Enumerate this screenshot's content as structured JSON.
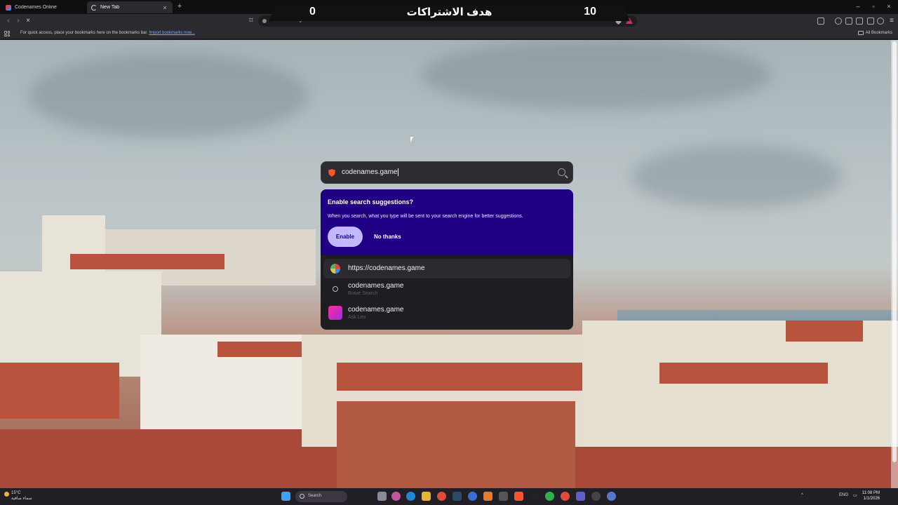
{
  "tabs": [
    {
      "label": "Codenames Online",
      "icon": "codenames-favicon-icon"
    },
    {
      "label": "New Tab",
      "icon": "loading-spinner-icon",
      "active": true
    }
  ],
  "overlay": {
    "left_value": "0",
    "title": "هدف الاشتراكات",
    "right_value": "10"
  },
  "address_bar": {
    "url": "codenames.game"
  },
  "bookmarks": {
    "prompt": "For quick access, place your bookmarks here on the bookmarks bar.",
    "import_link": "Import bookmarks now...",
    "all_bookmarks": "All Bookmarks"
  },
  "search": {
    "value": "codenames.game",
    "icon": "magnifier-icon"
  },
  "promo": {
    "title": "Enable search suggestions?",
    "description": "When you search, what you type will be sent to your search engine for better suggestions.",
    "enable_label": "Enable",
    "no_thanks_label": "No thanks",
    "bg_color": "#1f0085",
    "accent_color": "#c2b8ff"
  },
  "suggestions": [
    {
      "main": "https://codenames.game",
      "sub": "",
      "icon": "site-favicon-icon"
    },
    {
      "main": "codenames.game",
      "sub": "Brave Search",
      "icon": "search-icon"
    },
    {
      "main": "codenames.game",
      "sub": "Ask Leo",
      "icon": "leo-ai-icon"
    }
  ],
  "taskbar": {
    "weather_temp": "15°C",
    "weather_desc": "سماء صافية",
    "search_placeholder": "Search",
    "language": "ENG",
    "time": "11:08 PM",
    "date": "1/1/2026"
  }
}
